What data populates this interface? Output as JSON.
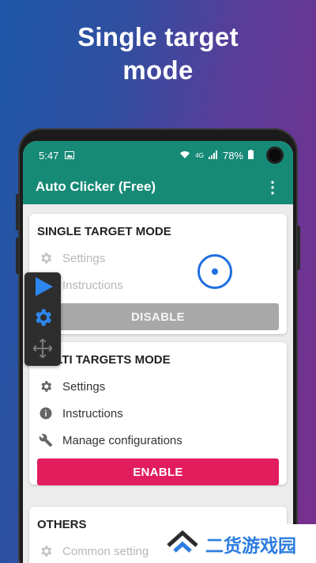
{
  "headline": {
    "line1": "Single target",
    "line2": "mode"
  },
  "statusbar": {
    "time": "5:47",
    "battery": "78%",
    "network": "4G"
  },
  "appbar": {
    "title": "Auto Clicker (Free)",
    "menu_icon": "more-vertical-icon"
  },
  "single_card": {
    "title": "SINGLE TARGET MODE",
    "settings": "Settings",
    "instructions": "Instructions",
    "button": "DISABLE"
  },
  "multi_card": {
    "title": "MULTI TARGETS MODE",
    "settings": "Settings",
    "instructions": "Instructions",
    "manage": "Manage configurations",
    "button": "ENABLE"
  },
  "others_card": {
    "title": "OTHERS",
    "common": "Common setting"
  },
  "watermark": {
    "text": "二货游戏园"
  },
  "colors": {
    "teal": "#168a76",
    "enable": "#e11d5d",
    "target": "#1e6fe0"
  }
}
